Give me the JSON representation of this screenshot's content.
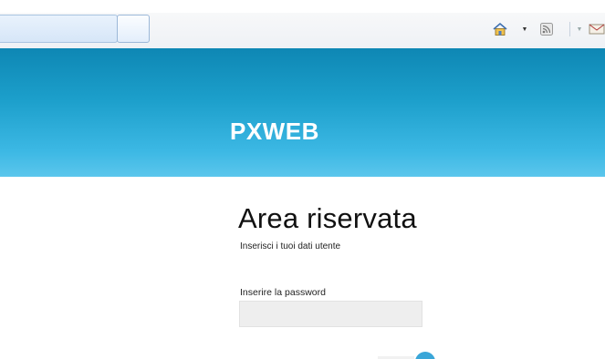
{
  "header": {
    "brand": "PXWEB"
  },
  "main": {
    "title": "Area riservata",
    "subtitle": "Inserisci i tuoi dati utente",
    "password_label": "Inserire la password",
    "password_value": "",
    "password_placeholder": ""
  },
  "toolbar": {
    "icons": [
      "home-icon",
      "feeds-icon",
      "mail-icon"
    ]
  },
  "colors": {
    "header_top": "#0e87b4",
    "header_bottom": "#5bc6ec",
    "input_bg": "#eeeeee",
    "submit_accent": "#3aa6d8"
  }
}
